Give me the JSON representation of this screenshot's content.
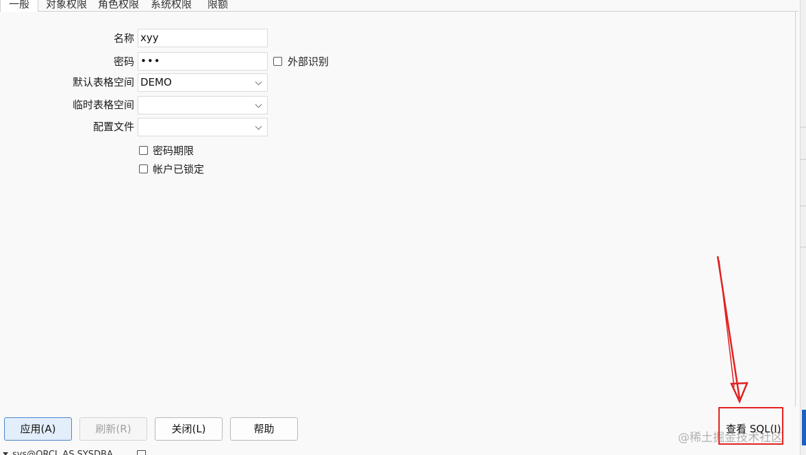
{
  "tabs": [
    {
      "label": "一般",
      "active": true
    },
    {
      "label": "对象权限",
      "active": false
    },
    {
      "label": "角色权限",
      "active": false
    },
    {
      "label": "系统权限",
      "active": false
    },
    {
      "label": "限额",
      "active": false
    }
  ],
  "form": {
    "name_label": "名称",
    "name_value": "xyy",
    "password_label": "密码",
    "password_value": "•••",
    "external_label": "外部识别",
    "default_ts_label": "默认表格空间",
    "default_ts_value": "DEMO",
    "temp_ts_label": "临时表格空间",
    "temp_ts_value": "",
    "profile_label": "配置文件",
    "profile_value": "",
    "password_expire_label": "密码期限",
    "account_locked_label": "帐户已锁定"
  },
  "buttons": {
    "apply": "应用(A)",
    "refresh": "刷新(R)",
    "close": "关闭(L)",
    "help": "帮助",
    "view_sql": "查看 SQL(I)"
  },
  "status": {
    "connection": "sys@ORCL AS SYSDBA"
  },
  "watermark": "@稀土掘金技术社区",
  "colors": {
    "annotation": "#e32020",
    "primary_button": "#e3eefb"
  }
}
